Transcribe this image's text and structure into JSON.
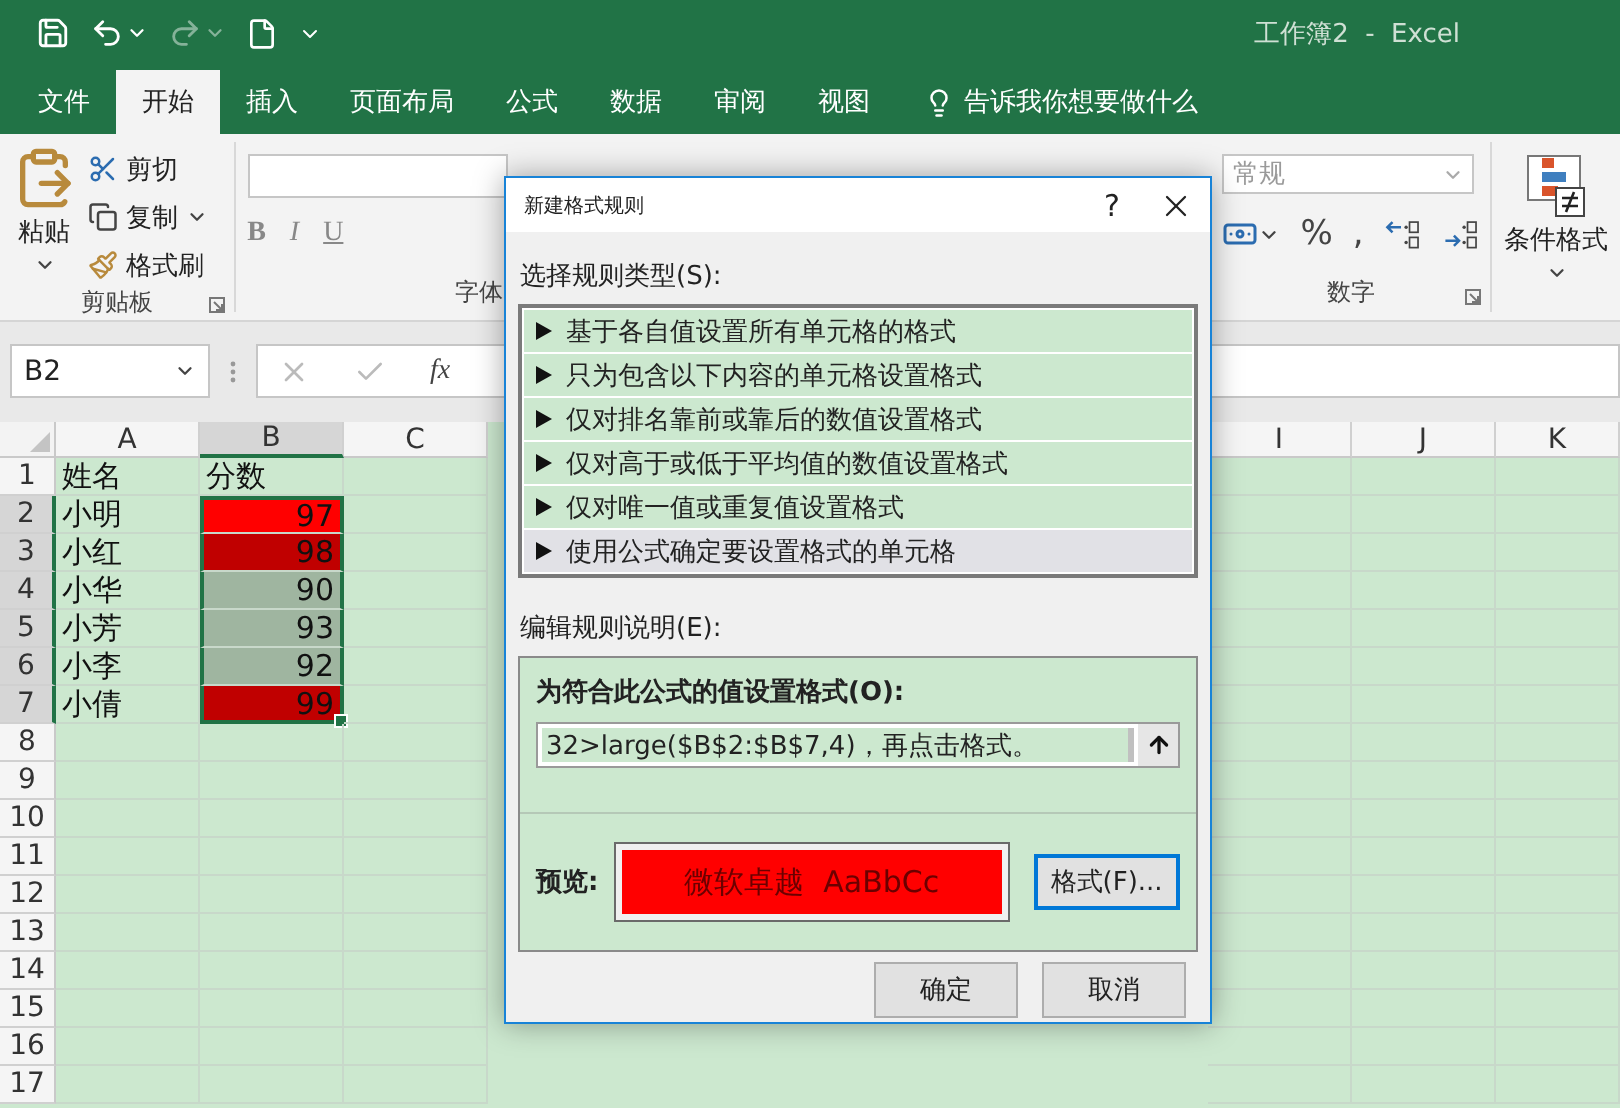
{
  "window": {
    "title": "工作簿2  -  Excel"
  },
  "ribbon_tabs": [
    {
      "label": "文件",
      "selected": false
    },
    {
      "label": "开始",
      "selected": true
    },
    {
      "label": "插入",
      "selected": false
    },
    {
      "label": "页面布局",
      "selected": false
    },
    {
      "label": "公式",
      "selected": false
    },
    {
      "label": "数据",
      "selected": false
    },
    {
      "label": "审阅",
      "selected": false
    },
    {
      "label": "视图",
      "selected": false
    }
  ],
  "tell_me": {
    "placeholder": "告诉我你想要做什么"
  },
  "clipboard": {
    "paste": "粘贴",
    "cut": "剪切",
    "copy": "复制",
    "format_painter": "格式刷",
    "label": "剪贴板"
  },
  "font": {
    "bold": "B",
    "italic": "I",
    "underline": "U",
    "label": "字体"
  },
  "number": {
    "format": "常规",
    "percent": "%",
    "comma": ",",
    "label": "数字"
  },
  "styles": {
    "conditional_format": "条件格式"
  },
  "formula_bar": {
    "name_box": "B2",
    "fx": "fx"
  },
  "sheet": {
    "columns": [
      {
        "kind": "letter",
        "label": "A",
        "selected": false
      },
      {
        "kind": "letter",
        "label": "B",
        "selected": true
      },
      {
        "kind": "letter",
        "label": "C",
        "selected": false
      },
      {
        "kind": "covered"
      },
      {
        "kind": "letter",
        "label": "I",
        "selected": false
      },
      {
        "kind": "letter",
        "label": "J",
        "selected": false
      },
      {
        "kind": "letter",
        "label": "K",
        "selected": false
      }
    ],
    "rows": [
      {
        "header": "1",
        "selected": false,
        "cells": [
          {
            "kind": "text",
            "text": "姓名",
            "selected": false
          },
          {
            "kind": "text",
            "text": "分数",
            "selected": false
          }
        ]
      },
      {
        "header": "2",
        "selected": true,
        "cells": [
          {
            "kind": "text",
            "text": "小明",
            "selected": false
          },
          {
            "kind": "number",
            "text": "97",
            "color": "#ff0000",
            "selected": true
          }
        ]
      },
      {
        "header": "3",
        "selected": true,
        "cells": [
          {
            "kind": "text",
            "text": "小红",
            "selected": false
          },
          {
            "kind": "number",
            "text": "98",
            "color": "#c00000",
            "selected": true
          }
        ]
      },
      {
        "header": "4",
        "selected": true,
        "cells": [
          {
            "kind": "text",
            "text": "小华",
            "selected": false
          },
          {
            "kind": "number",
            "text": "90",
            "color": "#9fb5a0",
            "selected": true
          }
        ]
      },
      {
        "header": "5",
        "selected": true,
        "cells": [
          {
            "kind": "text",
            "text": "小芳",
            "selected": false
          },
          {
            "kind": "number",
            "text": "93",
            "color": "#9fb5a0",
            "selected": true
          }
        ]
      },
      {
        "header": "6",
        "selected": true,
        "cells": [
          {
            "kind": "text",
            "text": "小李",
            "selected": false
          },
          {
            "kind": "number",
            "text": "92",
            "color": "#9fb5a0",
            "selected": true
          }
        ]
      },
      {
        "header": "7",
        "selected": true,
        "cells": [
          {
            "kind": "text",
            "text": "小倩",
            "selected": false
          },
          {
            "kind": "number",
            "text": "99",
            "color": "#c00000",
            "selected": true
          }
        ]
      },
      {
        "header": "8",
        "selected": false
      },
      {
        "header": "9",
        "selected": false
      },
      {
        "header": "10",
        "selected": false
      },
      {
        "header": "11",
        "selected": false
      },
      {
        "header": "12",
        "selected": false
      },
      {
        "header": "13",
        "selected": false
      },
      {
        "header": "14",
        "selected": false
      },
      {
        "header": "15",
        "selected": false
      },
      {
        "header": "16",
        "selected": false
      },
      {
        "header": "17",
        "selected": false
      }
    ]
  },
  "dialog": {
    "title": "新建格式规则",
    "help": "?",
    "rule_type_label": "选择规则类型(S):",
    "rule_types": [
      {
        "label": "基于各自值设置所有单元格的格式",
        "selected": false
      },
      {
        "label": "只为包含以下内容的单元格设置格式",
        "selected": false
      },
      {
        "label": "仅对排名靠前或靠后的数值设置格式",
        "selected": false
      },
      {
        "label": "仅对高于或低于平均值的数值设置格式",
        "selected": false
      },
      {
        "label": "仅对唯一值或重复值设置格式",
        "selected": false
      },
      {
        "label": "使用公式确定要设置格式的单元格",
        "selected": true
      }
    ],
    "edit_label": "编辑规则说明(E):",
    "formula_label": "为符合此公式的值设置格式(O):",
    "formula": "32>large($B$2:$B$7,4)，再点击格式。",
    "preview_label": "预览:",
    "preview_text": "微软卓越  AaBbCc",
    "format_button": {
      "label": "格式(F)...",
      "focused": true
    },
    "buttons": [
      {
        "label": "确定"
      },
      {
        "label": "取消"
      }
    ]
  }
}
